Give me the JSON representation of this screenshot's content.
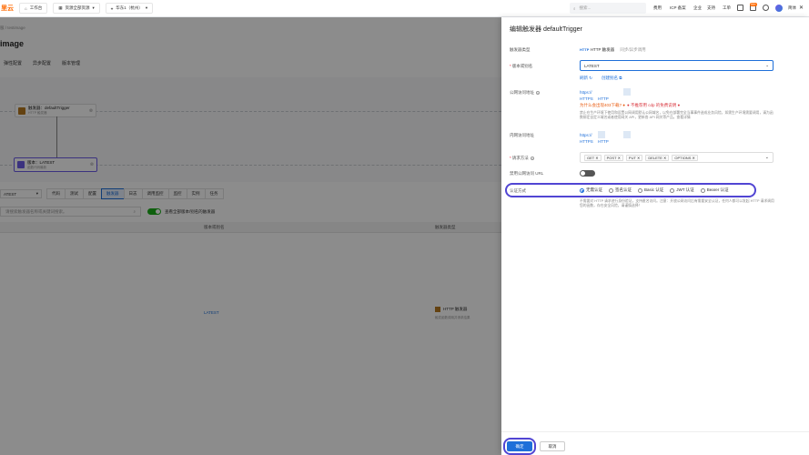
{
  "topbar": {
    "logo": "里云",
    "workbench": "工作台",
    "resource_group": "资源全部资源",
    "region": "华东1（杭州）",
    "search_placeholder": "搜索...",
    "links": [
      "费用",
      "ICP 备案",
      "企业",
      "支持",
      "工单"
    ],
    "badge": "99+",
    "user": "简体"
  },
  "left": {
    "breadcrumb": "服 / testimage",
    "function_title": "image",
    "sub_tabs": [
      "弹性配置",
      "异步配置",
      "版本管理"
    ],
    "trigger_node_title": "触发器：defaultTrigger",
    "trigger_node_sub": "HTTP 触发器",
    "version_node_title": "版本：LATEST",
    "version_node_sub": "函数代码最新",
    "version_select": "ATEST",
    "lower_tabs": [
      "代码",
      "测试",
      "配置",
      "触发器",
      "日志",
      "调用监控",
      "监控",
      "实例",
      "任务"
    ],
    "active_tab_index": 3,
    "trigger_search_placeholder": "请搜索触发器名称或关键词搜索。",
    "toggle_label": "查看全部版本/别名的触发器",
    "table_head_version": "版本或别名",
    "table_head_type": "触发器类型",
    "row_version": "LATEST",
    "row_type": "HTTP 触发器",
    "row_type_sub": "触发函数调用并请求结果"
  },
  "drawer": {
    "title": "编辑触发器 defaultTrigger",
    "trigger_type_label": "触发器类型",
    "trigger_type_value": "HTTP 触发器",
    "trigger_type_note": "同步/异步调用",
    "version_label": "版本或别名",
    "version_value": "LATEST",
    "refresh_link": "刷新",
    "create_alias_link": "创建别名",
    "public_url_label": "公网访问地址",
    "public_url_lines": [
      "https://",
      "HTTPS",
      "HTTP"
    ],
    "public_url_warn": "为什么会出现403下载?",
    "public_url_err": "不推荐用 cdp 的免费说明",
    "public_url_note": "禁止在生产环境下使用和设置公网调用默认公网域名，以免在部署完全当事事件造成业务风险。如需生产环境需要调用，请为函数绑定自定义域名或者使用网关 API，更新各 API 网关等产品。查看详情",
    "internal_url_label": "内网访问地址",
    "internal_url_lines": [
      "https://",
      "HTTPS",
      "HTTP"
    ],
    "method_label": "请求方法",
    "methods": [
      "GET",
      "POST",
      "PUT",
      "DELETE",
      "OPTIONS"
    ],
    "disable_url_label": "禁用公网访问 URL",
    "auth_label": "认证方式",
    "auth_options": [
      "无需认证",
      "签名认证",
      "Basic 认证",
      "JWT 认证",
      "Bearer 认证"
    ],
    "auth_selected_index": 0,
    "auth_note": "不需要对 HTTP 请求进行身份验证，支持匿名访问。注意：开放公网访问后有需要安全认证，任何人都可以发起 HTTP 请求调用您的函数，存在安全风险，请谨慎选择！",
    "ok_button": "确定",
    "cancel_button": "取消"
  },
  "colors": {
    "accent": "#1e6fd9",
    "highlight": "#5145d3",
    "brand": "#ff6a00"
  }
}
